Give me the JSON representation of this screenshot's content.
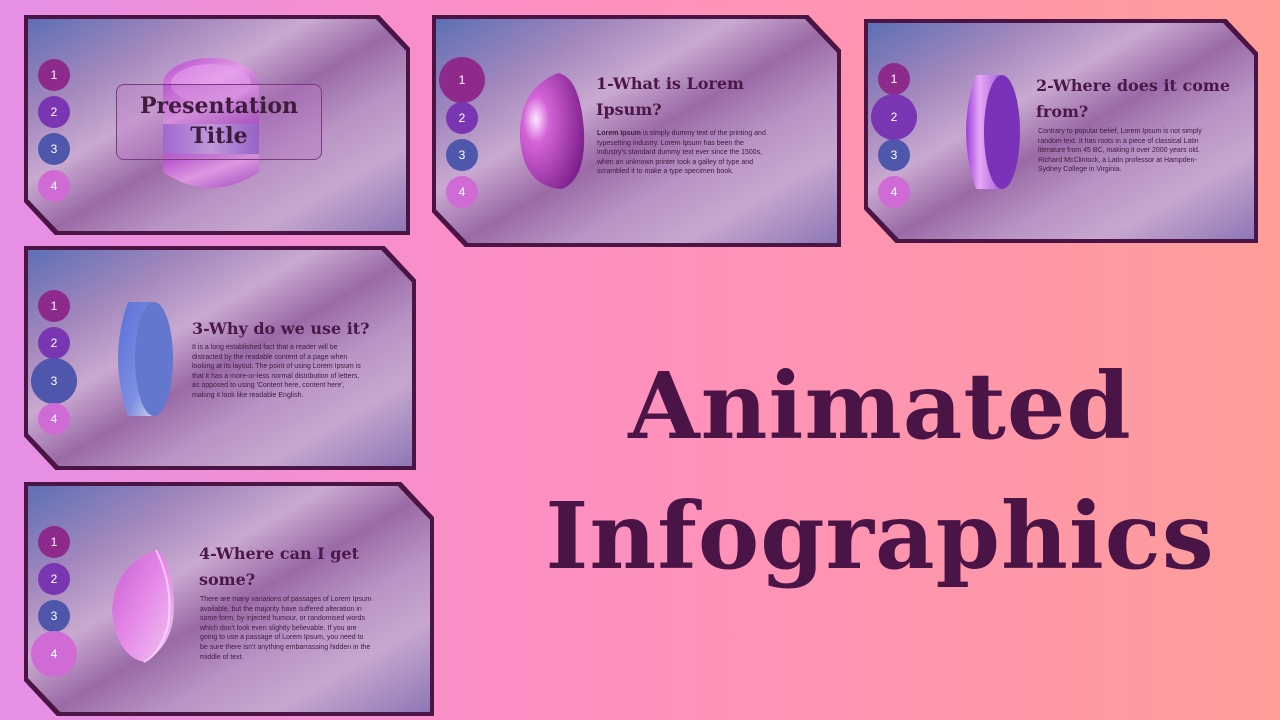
{
  "numbers": [
    "1",
    "2",
    "3",
    "4"
  ],
  "title_card": {
    "title_line1": "Presentation",
    "title_line2": "Title"
  },
  "card1": {
    "heading_line1": "1-What is Lorem",
    "heading_line2": "Ipsum?",
    "body_bold": "Lorem Ipsum",
    "body": " is simply dummy text of the printing and typesetting industry. Lorem Ipsum has been the industry's standard dummy text ever since the 1500s, when an unknown printer took a galley of type and scrambled it to make a type specimen book."
  },
  "card2": {
    "heading_line1": "2-Where does it come",
    "heading_line2": "from?",
    "body": "Contrary to popular belief, Lorem Ipsum is not simply random text. It has roots in a piece of classical Latin literature from 45 BC, making it over 2000 years old. Richard McClintock, a Latin professor at Hampden-Sydney College in Virginia."
  },
  "card3": {
    "heading_line1": "3-Why do we use it?",
    "body": "It is a long established fact that a reader will be distracted by the readable content of a page when looking at its layout. The point of using Lorem Ipsum is that it has a more-or-less normal distribution of letters, as opposed to using 'Content here, content here', making it look like readable English."
  },
  "card4": {
    "heading_line1": "4-Where can I get",
    "heading_line2": "some?",
    "body": "There are many variations of passages of Lorem Ipsum available, but the majority have suffered alteration in some form, by injected humour, or randomised words which don't look even slightly believable. If you are going to use a passage of Lorem Ipsum, you need to be sure there isn't anything embarrassing hidden in the middle of text."
  },
  "main_title": {
    "line1": "Animated",
    "line2": "Infographics"
  },
  "colors": {
    "dark_plum": "#4b1447",
    "num1": "#8e2a8c",
    "num2": "#7a36b2",
    "num3": "#4e57ab",
    "num4": "#d06bd6"
  }
}
